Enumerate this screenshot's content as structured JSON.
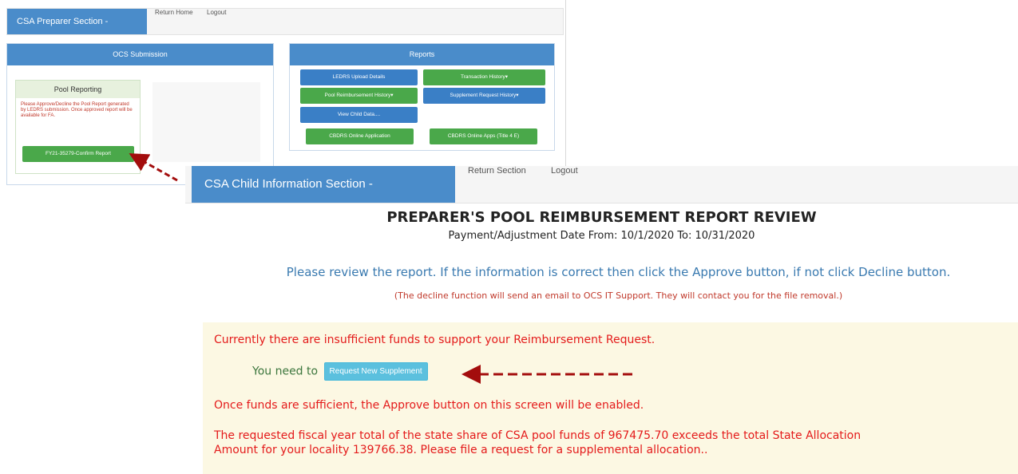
{
  "preparer_window": {
    "brand": "CSA Preparer Section -",
    "nav": [
      "Return Home",
      "Logout"
    ],
    "ocs_panel": {
      "title": "OCS Submission",
      "pool_reporting": {
        "title": "Pool Reporting",
        "message": "Please Approve/Decline the Pool Report generated by LEDRS submission. Once approved report will be available for FA.",
        "confirm_button": "FY21-35279-Confirm Report"
      }
    },
    "reports_panel": {
      "title": "Reports",
      "buttons": {
        "ledrs_upload": "LEDRS Upload Details",
        "transaction_history": "Transaction History▾",
        "pool_reimbursement_history": "Pool Reimbursement History▾",
        "supplement_request_history": "Supplement Request History▾",
        "view_child_data": "View Child Data....",
        "cbdrs_online": "CBDRS Online Application",
        "cbdrs_online_title4e": "CBDRS Online Apps (Title 4 E)"
      }
    }
  },
  "child_info_window": {
    "brand": "CSA Child Information Section -",
    "nav": [
      "Return Section",
      "Logout"
    ],
    "title": "PREPARER'S POOL REIMBURSEMENT REPORT REVIEW",
    "subtitle": "Payment/Adjustment Date From: 10/1/2020 To: 10/31/2020",
    "review_message": "Please review the report. If the information is correct then click the Approve button, if not click Decline button.",
    "decline_note": "(The decline function will send an email to OCS IT Support. They will contact you for the file removal.)",
    "alert": {
      "insufficient": "Currently there are insufficient funds to support your Reimbursement Request.",
      "you_need_to": "You need to",
      "request_button": "Request New Supplement",
      "once_sufficient": "Once funds are sufficient, the Approve button on this screen will be enabled.",
      "fiscal_line1": "The requested fiscal year total of the state share of CSA pool funds of 967475.70 exceeds the total State Allocation",
      "fiscal_line2": "Amount for your locality 139766.38. Please file a request for a supplemental allocation.."
    }
  },
  "colors": {
    "brand_blue": "#4a8cca",
    "green_button": "#4aa84a",
    "blue_button": "#3a7fc6",
    "alert_bg": "#fcf8e3",
    "alert_red": "#e41b1b",
    "arrow_red": "#a30d0d"
  }
}
